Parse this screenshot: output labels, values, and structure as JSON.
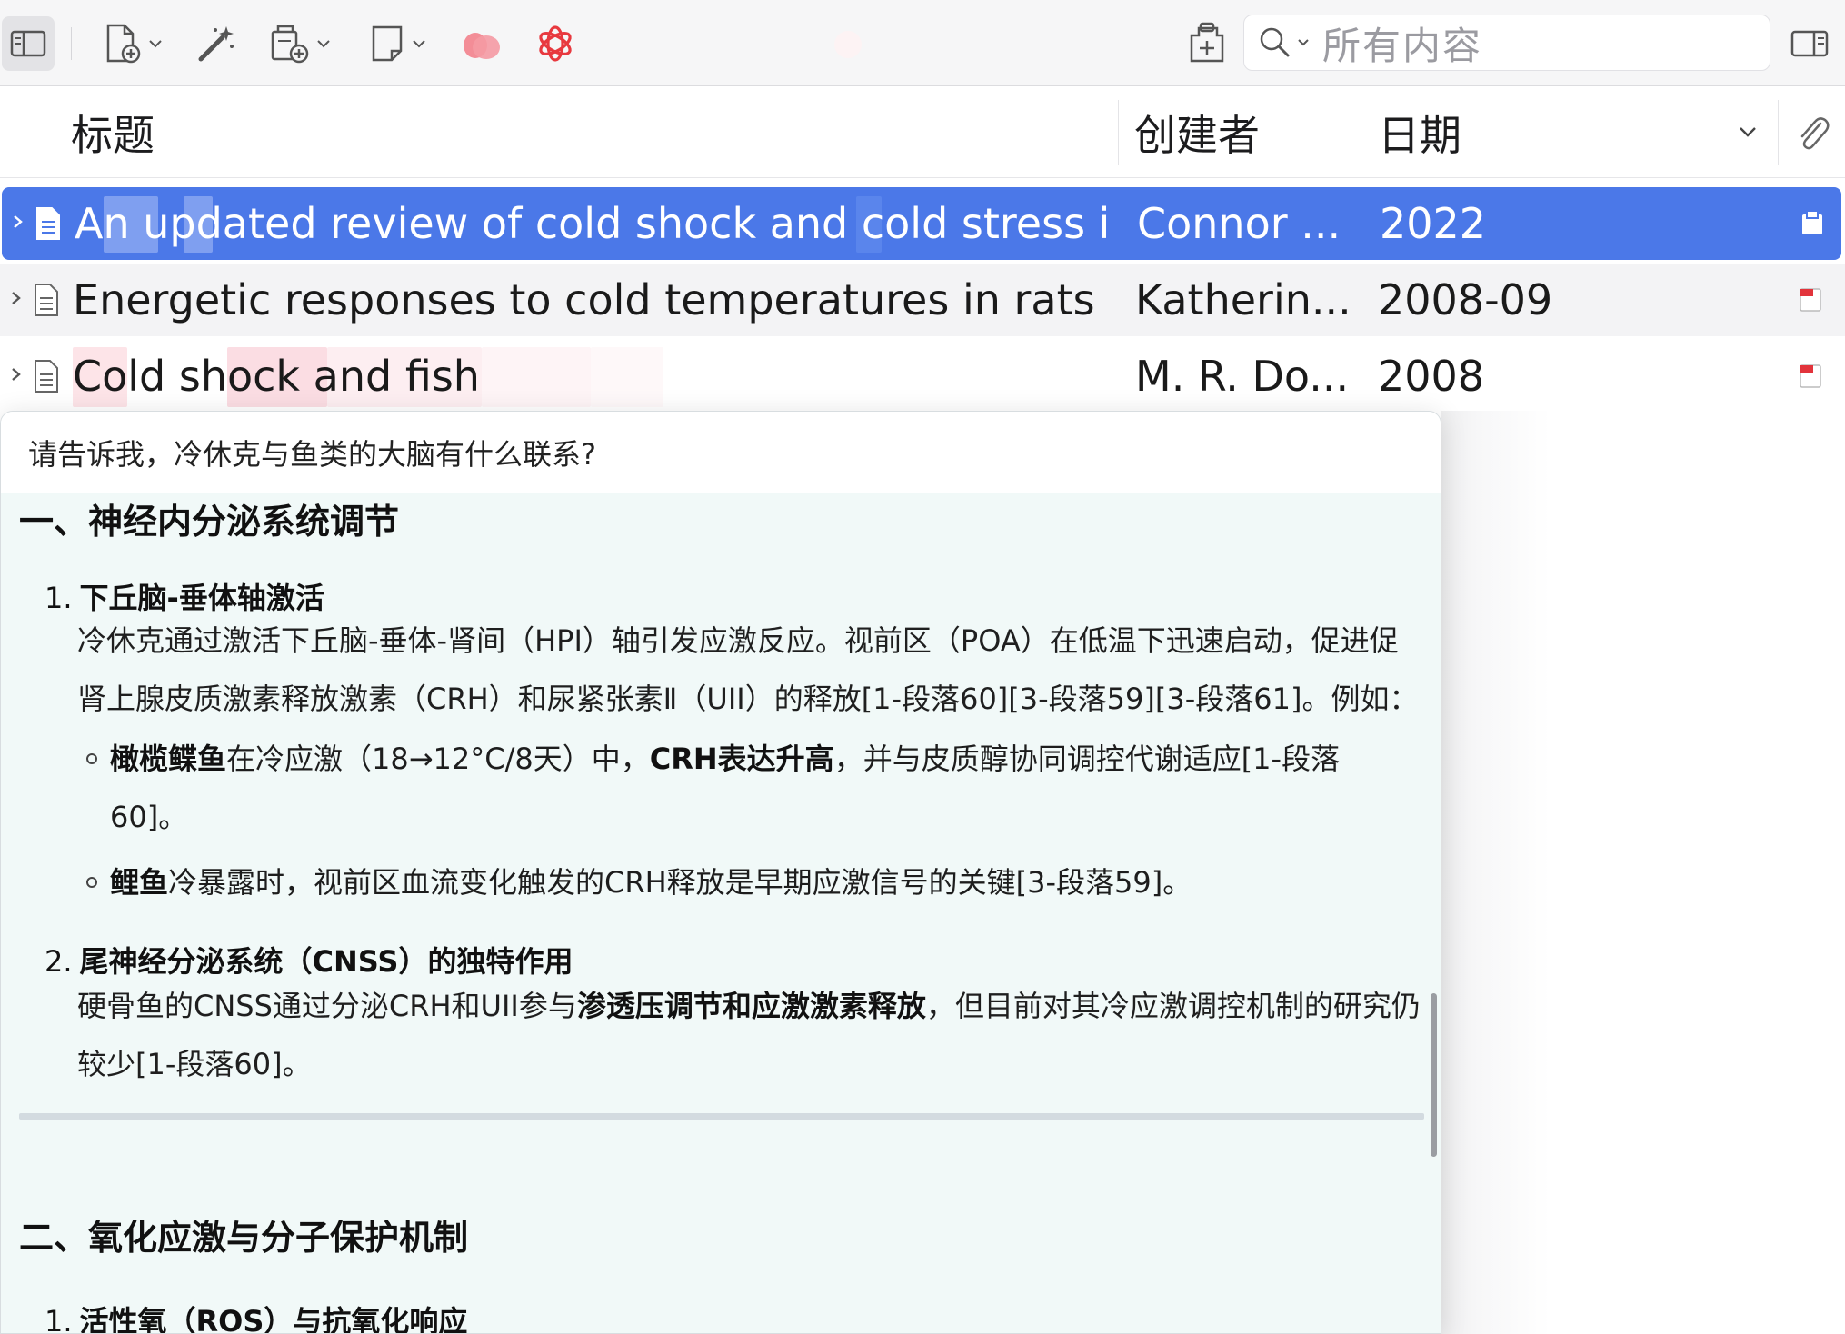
{
  "toolbar": {
    "search_placeholder": "所有内容",
    "icons": [
      "sidebar-toggle-icon",
      "new-item-icon",
      "magic-wand-icon",
      "add-attachment-icon",
      "new-note-icon",
      "lotus-plugin-icon",
      "openai-icon",
      "locate-icon",
      "search-icon",
      "pane-toggle-icon"
    ]
  },
  "columns": {
    "title": "标题",
    "creator": "创建者",
    "date": "日期"
  },
  "rows": [
    {
      "title": "An updated review of cold shock and cold stress in fish",
      "creator": "Connor ...",
      "date": "2022",
      "selected": true
    },
    {
      "title": "Energetic responses to cold temperatures in rats lackin",
      "creator": "Katherin...",
      "date": "2008-09",
      "selected": false
    },
    {
      "title": "Cold shock and fish",
      "creator": "M. R. Do...",
      "date": "2008",
      "selected": false
    }
  ],
  "chat": {
    "question": "请告诉我，冷休克与鱼类的大脑有什么联系?",
    "section1": {
      "heading": "一、神经内分泌系统调节",
      "item1": {
        "num": "1.",
        "title": "下丘脑-垂体轴激活",
        "para_line1": "冷休克通过激活下丘脑-垂体-肾间（HPI）轴引发应激反应。视前区（POA）在低温下迅速启动，促进促",
        "para_line2": "肾上腺皮质激素释放激素（CRH）和尿紧张素Ⅱ（UII）的释放[1-段落60][3-段落59][3-段落61]。例如：",
        "bullet1_bold": "橄榄鲽鱼",
        "bullet1_mid": "在冷应激（18→12°C/8天）中，",
        "bullet1_bold2": "CRH表达升高",
        "bullet1_rest": "，并与皮质醇协同调控代谢适应[1-段落",
        "bullet1_line2": "60]。",
        "bullet2_bold": "鲤鱼",
        "bullet2_rest": "冷暴露时，视前区血流变化触发的CRH释放是早期应激信号的关键[3-段落59]。"
      },
      "item2": {
        "num": "2.",
        "title": "尾神经分泌系统（CNSS）的独特作用",
        "para_pre": "硬骨鱼的CNSS通过分泌CRH和UII参与",
        "para_bold": "渗透压调节和应激激素释放",
        "para_post": "，但目前对其冷应激调控机制的研究仍",
        "para_line2": "较少[1-段落60]。"
      }
    },
    "section2": {
      "heading": "二、氧化应激与分子保护机制",
      "item1_num": "1.",
      "item1_title": "活性氧（ROS）与抗氧化响应"
    }
  }
}
